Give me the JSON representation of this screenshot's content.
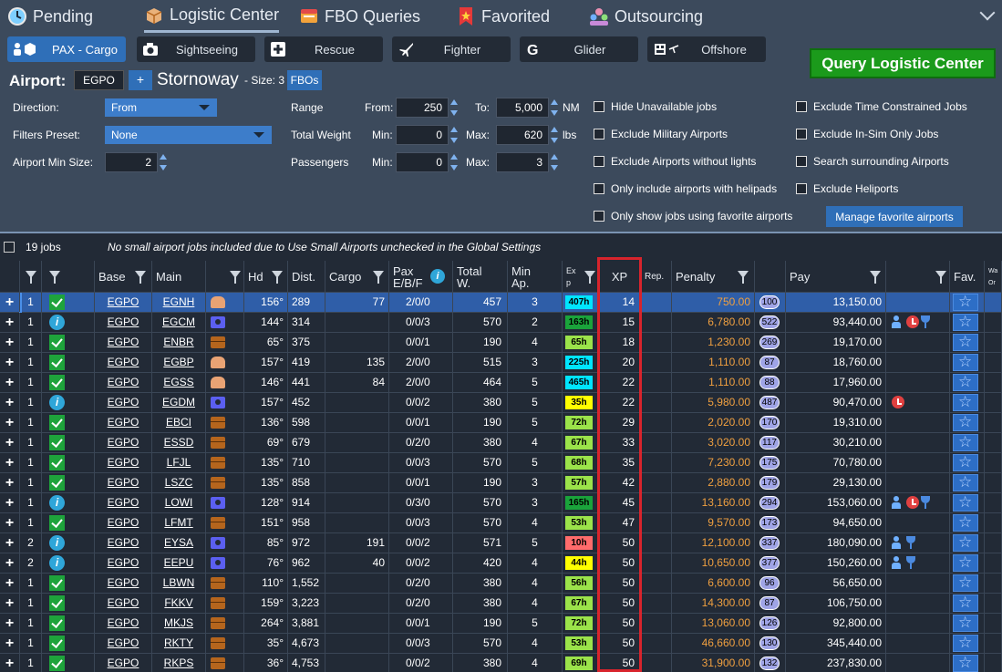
{
  "tabs": [
    {
      "label": "Pending",
      "icon": "clock-icon"
    },
    {
      "label": "Logistic Center",
      "icon": "box-icon"
    },
    {
      "label": "FBO Queries",
      "icon": "fbo-icon"
    },
    {
      "label": "Favorited",
      "icon": "star-bookmark-icon"
    },
    {
      "label": "Outsourcing",
      "icon": "people-icon"
    }
  ],
  "modes": [
    "PAX - Cargo",
    "Sightseeing",
    "Rescue",
    "Fighter",
    "Glider",
    "Offshore"
  ],
  "query_button": "Query Logistic Center",
  "airport": {
    "label": "Airport:",
    "code": "EGPO",
    "add": "+",
    "name": "Stornoway",
    "size": "- Size: 3",
    "fbo": "FBOs"
  },
  "filters": {
    "direction_label": "Direction:",
    "direction_value": "From",
    "preset_label": "Filters Preset:",
    "preset_value": "None",
    "minsize_label": "Airport Min Size:",
    "minsize_value": "2",
    "range_label": "Range",
    "range_from_label": "From:",
    "range_from": "250",
    "range_to_label": "To:",
    "range_to": "5,000",
    "range_unit": "NM",
    "weight_label": "Total Weight",
    "weight_min_label": "Min:",
    "weight_min": "0",
    "weight_max_label": "Max:",
    "weight_max": "620",
    "weight_unit": "lbs",
    "pax_label": "Passengers",
    "pax_min_label": "Min:",
    "pax_min": "0",
    "pax_max_label": "Max:",
    "pax_max": "3"
  },
  "checks": {
    "c1": "Hide Unavailable jobs",
    "c2": "Exclude Military Airports",
    "c3": "Exclude Airports without lights",
    "c4": "Only include airports with helipads",
    "c5": "Only show jobs using favorite airports",
    "d1": "Exclude Time Constrained Jobs",
    "d2": "Exclude In-Sim Only Jobs",
    "d3": "Search surrounding Airports",
    "d4": "Exclude Heliports"
  },
  "manage_button": "Manage favorite airports",
  "jobs_count": "19 jobs",
  "jobs_message": "No small airport jobs included due to Use Small Airports unchecked in the Global Settings",
  "headers": {
    "base": "Base",
    "main": "Main",
    "hd": "Hd",
    "dist": "Dist.",
    "cargo": "Cargo",
    "pax1": "Pax",
    "pax2": "E/B/F",
    "total1": "Total",
    "total2": "W.",
    "minap1": "Min",
    "minap2": "Ap.",
    "exp1": "Ex",
    "exp2": "p",
    "xp": "XP",
    "rep": "Rep.",
    "penalty": "Penalty",
    "pay": "Pay",
    "fav": "Fav.",
    "last1": "Wa",
    "last2": "Or"
  },
  "rows": [
    {
      "n": "1",
      "status": "ok",
      "base": "EGPO",
      "main": "EGNH",
      "type": "pax",
      "hd": "156°",
      "dist": "289",
      "cargo": "77",
      "pax": "2/0/0",
      "tw": "457",
      "minap": "3",
      "exp": "407h",
      "expc": "#00e5ff",
      "xp": "14",
      "penalty": "750.00",
      "rep": "100",
      "pay": "13,150.00",
      "icons": []
    },
    {
      "n": "1",
      "status": "info",
      "base": "EGPO",
      "main": "EGCM",
      "type": "cam",
      "hd": "144°",
      "dist": "314",
      "cargo": "",
      "pax": "0/0/3",
      "tw": "570",
      "minap": "2",
      "exp": "163h",
      "expc": "#1aa33b",
      "xp": "15",
      "penalty": "6,780.00",
      "rep": "522",
      "pay": "93,440.00",
      "icons": [
        "person",
        "clock",
        "glass"
      ]
    },
    {
      "n": "1",
      "status": "ok",
      "base": "EGPO",
      "main": "ENBR",
      "type": "box",
      "hd": "65°",
      "dist": "375",
      "cargo": "",
      "pax": "0/0/1",
      "tw": "190",
      "minap": "4",
      "exp": "65h",
      "expc": "#9be34a",
      "xp": "18",
      "penalty": "1,230.00",
      "rep": "269",
      "pay": "19,170.00",
      "icons": []
    },
    {
      "n": "1",
      "status": "ok",
      "base": "EGPO",
      "main": "EGBP",
      "type": "pax",
      "hd": "157°",
      "dist": "419",
      "cargo": "135",
      "pax": "2/0/0",
      "tw": "515",
      "minap": "3",
      "exp": "225h",
      "expc": "#00e5ff",
      "xp": "20",
      "penalty": "1,110.00",
      "rep": "87",
      "pay": "18,760.00",
      "icons": []
    },
    {
      "n": "1",
      "status": "ok",
      "base": "EGPO",
      "main": "EGSS",
      "type": "pax",
      "hd": "146°",
      "dist": "441",
      "cargo": "84",
      "pax": "2/0/0",
      "tw": "464",
      "minap": "5",
      "exp": "465h",
      "expc": "#00e5ff",
      "xp": "22",
      "penalty": "1,110.00",
      "rep": "88",
      "pay": "17,960.00",
      "icons": []
    },
    {
      "n": "1",
      "status": "info",
      "base": "EGPO",
      "main": "EGDM",
      "type": "cam",
      "hd": "157°",
      "dist": "452",
      "cargo": "",
      "pax": "0/0/2",
      "tw": "380",
      "minap": "5",
      "exp": "35h",
      "expc": "#ffff00",
      "xp": "22",
      "penalty": "5,980.00",
      "rep": "487",
      "pay": "90,470.00",
      "icons": [
        "clock"
      ]
    },
    {
      "n": "1",
      "status": "ok",
      "base": "EGPO",
      "main": "EBCI",
      "type": "box",
      "hd": "136°",
      "dist": "598",
      "cargo": "",
      "pax": "0/0/1",
      "tw": "190",
      "minap": "5",
      "exp": "72h",
      "expc": "#9be34a",
      "xp": "29",
      "penalty": "2,020.00",
      "rep": "170",
      "pay": "19,310.00",
      "icons": []
    },
    {
      "n": "1",
      "status": "ok",
      "base": "EGPO",
      "main": "ESSD",
      "type": "box",
      "hd": "69°",
      "dist": "679",
      "cargo": "",
      "pax": "0/2/0",
      "tw": "380",
      "minap": "4",
      "exp": "67h",
      "expc": "#9be34a",
      "xp": "33",
      "penalty": "3,020.00",
      "rep": "117",
      "pay": "30,210.00",
      "icons": []
    },
    {
      "n": "1",
      "status": "ok",
      "base": "EGPO",
      "main": "LFJL",
      "type": "box",
      "hd": "135°",
      "dist": "710",
      "cargo": "",
      "pax": "0/0/3",
      "tw": "570",
      "minap": "5",
      "exp": "68h",
      "expc": "#9be34a",
      "xp": "35",
      "penalty": "7,230.00",
      "rep": "175",
      "pay": "70,780.00",
      "icons": []
    },
    {
      "n": "1",
      "status": "ok",
      "base": "EGPO",
      "main": "LSZC",
      "type": "box",
      "hd": "135°",
      "dist": "858",
      "cargo": "",
      "pax": "0/0/1",
      "tw": "190",
      "minap": "3",
      "exp": "57h",
      "expc": "#9be34a",
      "xp": "42",
      "penalty": "2,880.00",
      "rep": "179",
      "pay": "29,130.00",
      "icons": []
    },
    {
      "n": "1",
      "status": "info",
      "base": "EGPO",
      "main": "LOWI",
      "type": "cam",
      "hd": "128°",
      "dist": "914",
      "cargo": "",
      "pax": "0/3/0",
      "tw": "570",
      "minap": "3",
      "exp": "165h",
      "expc": "#1aa33b",
      "xp": "45",
      "penalty": "13,160.00",
      "rep": "294",
      "pay": "153,060.00",
      "icons": [
        "person",
        "clock",
        "glass"
      ]
    },
    {
      "n": "1",
      "status": "ok",
      "base": "EGPO",
      "main": "LFMT",
      "type": "box",
      "hd": "151°",
      "dist": "958",
      "cargo": "",
      "pax": "0/0/3",
      "tw": "570",
      "minap": "4",
      "exp": "53h",
      "expc": "#9be34a",
      "xp": "47",
      "penalty": "9,570.00",
      "rep": "173",
      "pay": "94,650.00",
      "icons": []
    },
    {
      "n": "2",
      "status": "info",
      "base": "EGPO",
      "main": "EYSA",
      "type": "cam",
      "hd": "85°",
      "dist": "972",
      "cargo": "191",
      "pax": "0/0/2",
      "tw": "571",
      "minap": "5",
      "exp": "10h",
      "expc": "#ff6b6b",
      "xp": "50",
      "penalty": "12,100.00",
      "rep": "337",
      "pay": "180,090.00",
      "icons": [
        "person",
        "glass"
      ]
    },
    {
      "n": "2",
      "status": "info",
      "base": "EGPO",
      "main": "EEPU",
      "type": "cam",
      "hd": "76°",
      "dist": "962",
      "cargo": "40",
      "pax": "0/0/2",
      "tw": "420",
      "minap": "4",
      "exp": "44h",
      "expc": "#ffff00",
      "xp": "50",
      "penalty": "10,650.00",
      "rep": "377",
      "pay": "150,260.00",
      "icons": [
        "person",
        "glass"
      ]
    },
    {
      "n": "1",
      "status": "ok",
      "base": "EGPO",
      "main": "LBWN",
      "type": "box",
      "hd": "110°",
      "dist": "1,552",
      "cargo": "",
      "pax": "0/2/0",
      "tw": "380",
      "minap": "4",
      "exp": "56h",
      "expc": "#9be34a",
      "xp": "50",
      "penalty": "6,600.00",
      "rep": "96",
      "pay": "56,650.00",
      "icons": []
    },
    {
      "n": "1",
      "status": "ok",
      "base": "EGPO",
      "main": "FKKV",
      "type": "box",
      "hd": "159°",
      "dist": "3,223",
      "cargo": "",
      "pax": "0/2/0",
      "tw": "380",
      "minap": "4",
      "exp": "67h",
      "expc": "#9be34a",
      "xp": "50",
      "penalty": "14,300.00",
      "rep": "87",
      "pay": "106,750.00",
      "icons": []
    },
    {
      "n": "1",
      "status": "ok",
      "base": "EGPO",
      "main": "MKJS",
      "type": "box",
      "hd": "264°",
      "dist": "3,881",
      "cargo": "",
      "pax": "0/0/1",
      "tw": "190",
      "minap": "5",
      "exp": "72h",
      "expc": "#9be34a",
      "xp": "50",
      "penalty": "13,060.00",
      "rep": "126",
      "pay": "92,800.00",
      "icons": []
    },
    {
      "n": "1",
      "status": "ok",
      "base": "EGPO",
      "main": "RKTY",
      "type": "box",
      "hd": "35°",
      "dist": "4,673",
      "cargo": "",
      "pax": "0/0/3",
      "tw": "570",
      "minap": "4",
      "exp": "53h",
      "expc": "#9be34a",
      "xp": "50",
      "penalty": "46,660.00",
      "rep": "130",
      "pay": "345,440.00",
      "icons": []
    },
    {
      "n": "1",
      "status": "ok",
      "base": "EGPO",
      "main": "RKPS",
      "type": "box",
      "hd": "36°",
      "dist": "4,753",
      "cargo": "",
      "pax": "0/0/2",
      "tw": "380",
      "minap": "4",
      "exp": "69h",
      "expc": "#9be34a",
      "xp": "50",
      "penalty": "31,900.00",
      "rep": "132",
      "pay": "237,830.00",
      "icons": []
    }
  ]
}
